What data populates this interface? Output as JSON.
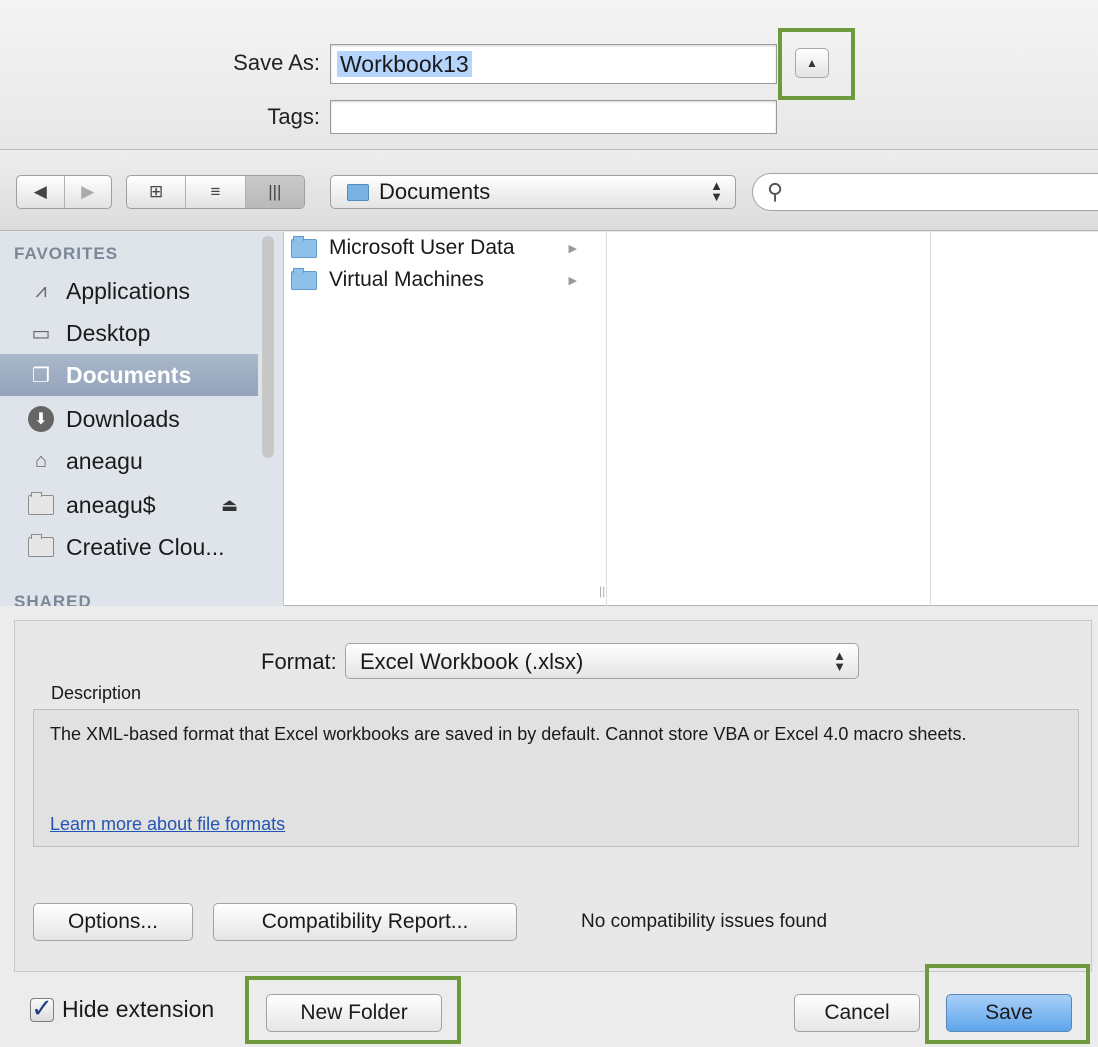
{
  "save_as": {
    "label": "Save As:",
    "value": "Workbook13",
    "tags_label": "Tags:",
    "tags_value": "",
    "expand_icon": "▲"
  },
  "toolbar": {
    "back_icon": "◀",
    "forward_icon": "▶",
    "icon_view_icon": "⊞",
    "list_view_icon": "≡",
    "column_view_icon": "|||",
    "location": "Documents",
    "search_value": "",
    "search_icon": "magnifier"
  },
  "sidebar": {
    "favorites_heading": "FAVORITES",
    "shared_heading": "SHARED",
    "items": [
      {
        "label": "Applications",
        "icon": "applications-icon"
      },
      {
        "label": "Desktop",
        "icon": "desktop-icon"
      },
      {
        "label": "Documents",
        "icon": "documents-icon",
        "selected": true
      },
      {
        "label": "Downloads",
        "icon": "downloads-icon"
      },
      {
        "label": "aneagu",
        "icon": "home-icon"
      },
      {
        "label": "aneagu$",
        "icon": "folder-icon",
        "eject": "⏏"
      },
      {
        "label": "Creative Clou...",
        "icon": "folder-icon"
      }
    ]
  },
  "browser": {
    "column1": [
      {
        "name": "Microsoft User Data",
        "has_children": true
      },
      {
        "name": "Virtual Machines",
        "has_children": true
      }
    ]
  },
  "format": {
    "label": "Format:",
    "value": "Excel Workbook (.xlsx)",
    "description_label": "Description",
    "description": "The XML-based format that Excel workbooks are saved in by default. Cannot store VBA or Excel 4.0 macro sheets.",
    "learn_more": "Learn more about file formats"
  },
  "buttons": {
    "options": "Options...",
    "compatibility_report": "Compatibility Report...",
    "compatibility_message": "No compatibility issues found",
    "hide_extension": "Hide extension",
    "hide_extension_checked": true,
    "new_folder": "New Folder",
    "cancel": "Cancel",
    "save": "Save"
  },
  "colors": {
    "highlight_box": "#6c9a3c",
    "save_button": "#5ea5ec",
    "selected_sidebar": "#93a3ba",
    "text_selection": "#b5d5fd"
  }
}
